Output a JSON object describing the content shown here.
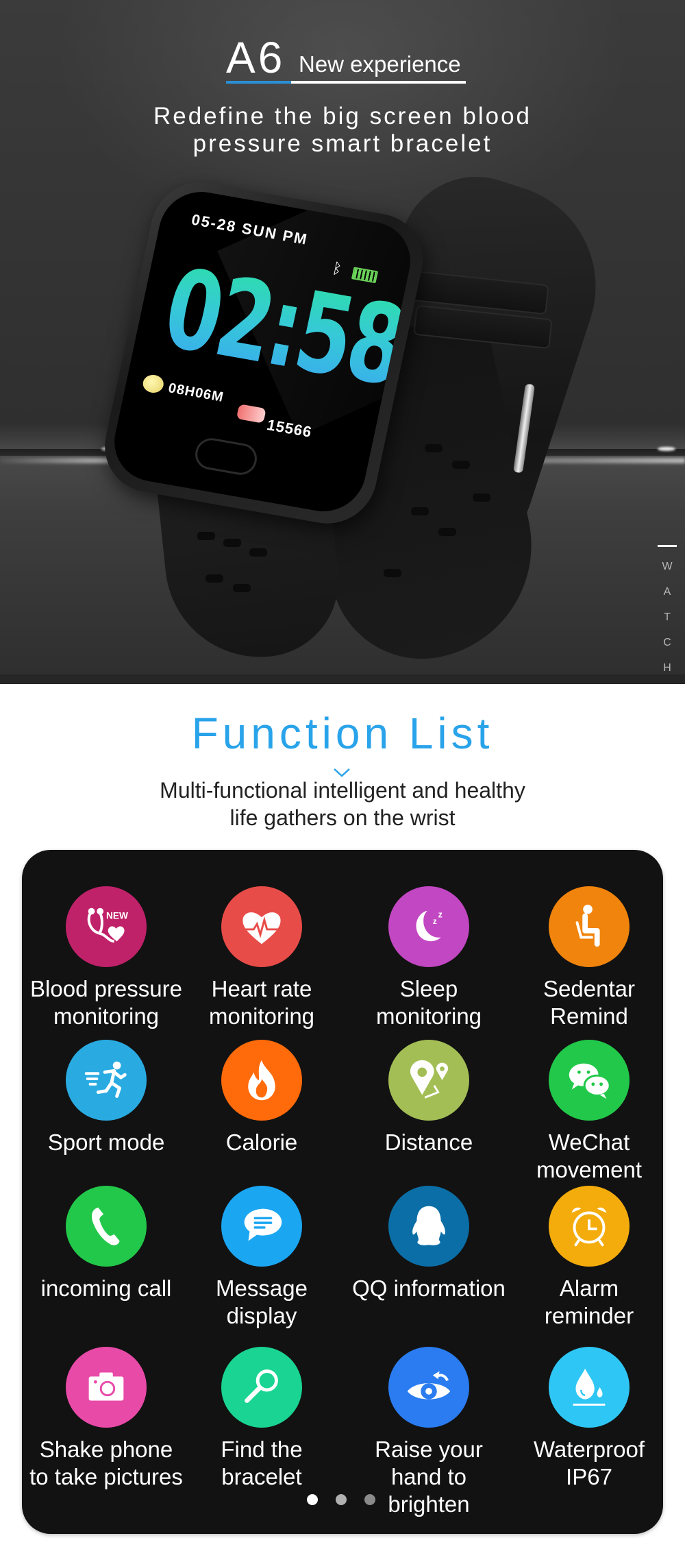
{
  "hero": {
    "model": "A6",
    "tagline": "New experience",
    "subtitle_line1": "Redefine the big screen blood",
    "subtitle_line2": "pressure smart bracelet",
    "accent_color": "#2b8fd6",
    "side_label_letters": [
      "W",
      "A",
      "T",
      "C",
      "H"
    ],
    "watch_face": {
      "date": "05-28 SUN PM",
      "time": "02:58",
      "sleep": "08H06M",
      "steps": "15566",
      "bluetooth_icon": "ᛒ"
    }
  },
  "function_list": {
    "title": "Function List",
    "title_color": "#29a3ea",
    "subtitle_line1": "Multi-functional intelligent and healthy",
    "subtitle_line2": "life gathers on the wrist",
    "features": [
      {
        "label_line1": "Blood pressure",
        "label_line2": "monitoring",
        "icon": "stethoscope-heart-icon",
        "badge": "NEW",
        "color": "#c0226a"
      },
      {
        "label_line1": "Heart rate",
        "label_line2": "monitoring",
        "icon": "heart-pulse-icon",
        "color": "#e84c48"
      },
      {
        "label_line1": "Sleep",
        "label_line2": "monitoring",
        "icon": "moon-sleep-icon",
        "color": "#c247c2"
      },
      {
        "label_line1": "Sedentar",
        "label_line2": "Remind",
        "icon": "seated-person-icon",
        "color": "#f0840c"
      },
      {
        "label_line1": "Sport mode",
        "label_line2": "",
        "icon": "running-person-icon",
        "color": "#29abe2"
      },
      {
        "label_line1": "Calorie",
        "label_line2": "",
        "icon": "flame-icon",
        "color": "#ff6a0a"
      },
      {
        "label_line1": "Distance",
        "label_line2": "",
        "icon": "map-pin-route-icon",
        "color": "#a3be55"
      },
      {
        "label_line1": "WeChat",
        "label_line2": "movement",
        "icon": "wechat-icon",
        "color": "#22c84a"
      },
      {
        "label_line1": "incoming call",
        "label_line2": "",
        "icon": "phone-icon",
        "color": "#22c84a"
      },
      {
        "label_line1": "Message",
        "label_line2": "display",
        "icon": "chat-bubble-icon",
        "color": "#1ba6f2"
      },
      {
        "label_line1": "QQ information",
        "label_line2": "",
        "icon": "qq-penguin-icon",
        "color": "#0b6ea6"
      },
      {
        "label_line1": "Alarm",
        "label_line2": "reminder",
        "icon": "alarm-clock-icon",
        "color": "#f4ac0c"
      },
      {
        "label_line1": "Shake phone",
        "label_line2": "to take pictures",
        "icon": "camera-icon",
        "color": "#e84aa8"
      },
      {
        "label_line1": "Find the",
        "label_line2": "bracelet",
        "icon": "magnifier-icon",
        "color": "#19d492"
      },
      {
        "label_line1": "Raise your",
        "label_line2": "hand to brighten",
        "icon": "eye-raise-icon",
        "color": "#2a7cf0"
      },
      {
        "label_line1": "Waterproof",
        "label_line2": "IP67",
        "icon": "water-drop-icon",
        "color": "#2ec6f4"
      }
    ],
    "pager": {
      "total": 3,
      "active": 0
    }
  }
}
